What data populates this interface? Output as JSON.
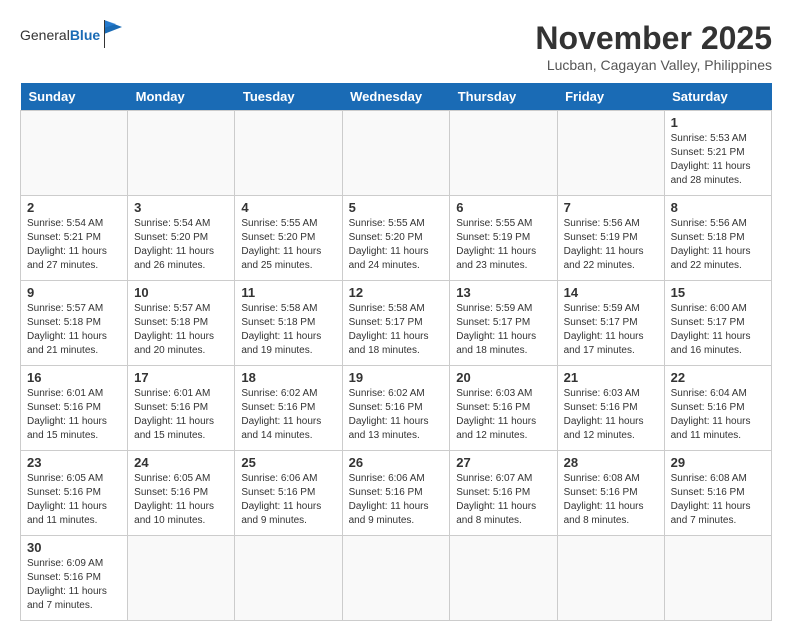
{
  "header": {
    "logo_general": "General",
    "logo_blue": "Blue",
    "title": "November 2025",
    "subtitle": "Lucban, Cagayan Valley, Philippines"
  },
  "days_of_week": [
    "Sunday",
    "Monday",
    "Tuesday",
    "Wednesday",
    "Thursday",
    "Friday",
    "Saturday"
  ],
  "weeks": [
    [
      {
        "date": "",
        "info": ""
      },
      {
        "date": "",
        "info": ""
      },
      {
        "date": "",
        "info": ""
      },
      {
        "date": "",
        "info": ""
      },
      {
        "date": "",
        "info": ""
      },
      {
        "date": "",
        "info": ""
      },
      {
        "date": "1",
        "info": "Sunrise: 5:53 AM\nSunset: 5:21 PM\nDaylight: 11 hours\nand 28 minutes."
      }
    ],
    [
      {
        "date": "2",
        "info": "Sunrise: 5:54 AM\nSunset: 5:21 PM\nDaylight: 11 hours\nand 27 minutes."
      },
      {
        "date": "3",
        "info": "Sunrise: 5:54 AM\nSunset: 5:20 PM\nDaylight: 11 hours\nand 26 minutes."
      },
      {
        "date": "4",
        "info": "Sunrise: 5:55 AM\nSunset: 5:20 PM\nDaylight: 11 hours\nand 25 minutes."
      },
      {
        "date": "5",
        "info": "Sunrise: 5:55 AM\nSunset: 5:20 PM\nDaylight: 11 hours\nand 24 minutes."
      },
      {
        "date": "6",
        "info": "Sunrise: 5:55 AM\nSunset: 5:19 PM\nDaylight: 11 hours\nand 23 minutes."
      },
      {
        "date": "7",
        "info": "Sunrise: 5:56 AM\nSunset: 5:19 PM\nDaylight: 11 hours\nand 22 minutes."
      },
      {
        "date": "8",
        "info": "Sunrise: 5:56 AM\nSunset: 5:18 PM\nDaylight: 11 hours\nand 22 minutes."
      }
    ],
    [
      {
        "date": "9",
        "info": "Sunrise: 5:57 AM\nSunset: 5:18 PM\nDaylight: 11 hours\nand 21 minutes."
      },
      {
        "date": "10",
        "info": "Sunrise: 5:57 AM\nSunset: 5:18 PM\nDaylight: 11 hours\nand 20 minutes."
      },
      {
        "date": "11",
        "info": "Sunrise: 5:58 AM\nSunset: 5:18 PM\nDaylight: 11 hours\nand 19 minutes."
      },
      {
        "date": "12",
        "info": "Sunrise: 5:58 AM\nSunset: 5:17 PM\nDaylight: 11 hours\nand 18 minutes."
      },
      {
        "date": "13",
        "info": "Sunrise: 5:59 AM\nSunset: 5:17 PM\nDaylight: 11 hours\nand 18 minutes."
      },
      {
        "date": "14",
        "info": "Sunrise: 5:59 AM\nSunset: 5:17 PM\nDaylight: 11 hours\nand 17 minutes."
      },
      {
        "date": "15",
        "info": "Sunrise: 6:00 AM\nSunset: 5:17 PM\nDaylight: 11 hours\nand 16 minutes."
      }
    ],
    [
      {
        "date": "16",
        "info": "Sunrise: 6:01 AM\nSunset: 5:16 PM\nDaylight: 11 hours\nand 15 minutes."
      },
      {
        "date": "17",
        "info": "Sunrise: 6:01 AM\nSunset: 5:16 PM\nDaylight: 11 hours\nand 15 minutes."
      },
      {
        "date": "18",
        "info": "Sunrise: 6:02 AM\nSunset: 5:16 PM\nDaylight: 11 hours\nand 14 minutes."
      },
      {
        "date": "19",
        "info": "Sunrise: 6:02 AM\nSunset: 5:16 PM\nDaylight: 11 hours\nand 13 minutes."
      },
      {
        "date": "20",
        "info": "Sunrise: 6:03 AM\nSunset: 5:16 PM\nDaylight: 11 hours\nand 12 minutes."
      },
      {
        "date": "21",
        "info": "Sunrise: 6:03 AM\nSunset: 5:16 PM\nDaylight: 11 hours\nand 12 minutes."
      },
      {
        "date": "22",
        "info": "Sunrise: 6:04 AM\nSunset: 5:16 PM\nDaylight: 11 hours\nand 11 minutes."
      }
    ],
    [
      {
        "date": "23",
        "info": "Sunrise: 6:05 AM\nSunset: 5:16 PM\nDaylight: 11 hours\nand 11 minutes."
      },
      {
        "date": "24",
        "info": "Sunrise: 6:05 AM\nSunset: 5:16 PM\nDaylight: 11 hours\nand 10 minutes."
      },
      {
        "date": "25",
        "info": "Sunrise: 6:06 AM\nSunset: 5:16 PM\nDaylight: 11 hours\nand 9 minutes."
      },
      {
        "date": "26",
        "info": "Sunrise: 6:06 AM\nSunset: 5:16 PM\nDaylight: 11 hours\nand 9 minutes."
      },
      {
        "date": "27",
        "info": "Sunrise: 6:07 AM\nSunset: 5:16 PM\nDaylight: 11 hours\nand 8 minutes."
      },
      {
        "date": "28",
        "info": "Sunrise: 6:08 AM\nSunset: 5:16 PM\nDaylight: 11 hours\nand 8 minutes."
      },
      {
        "date": "29",
        "info": "Sunrise: 6:08 AM\nSunset: 5:16 PM\nDaylight: 11 hours\nand 7 minutes."
      }
    ],
    [
      {
        "date": "30",
        "info": "Sunrise: 6:09 AM\nSunset: 5:16 PM\nDaylight: 11 hours\nand 7 minutes."
      },
      {
        "date": "",
        "info": ""
      },
      {
        "date": "",
        "info": ""
      },
      {
        "date": "",
        "info": ""
      },
      {
        "date": "",
        "info": ""
      },
      {
        "date": "",
        "info": ""
      },
      {
        "date": "",
        "info": ""
      }
    ]
  ]
}
